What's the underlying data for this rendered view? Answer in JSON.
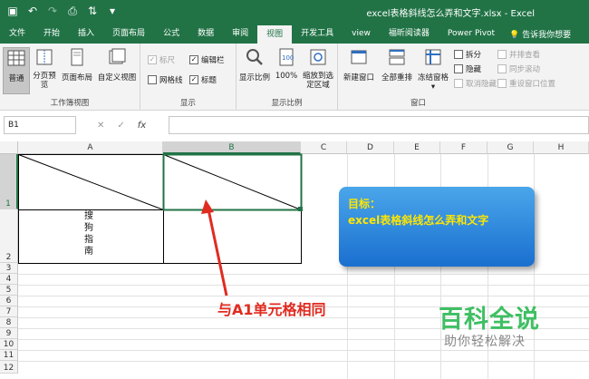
{
  "window": {
    "title": "excel表格斜线怎么弄和文字.xlsx - Excel"
  },
  "ribbon_tabs": [
    "文件",
    "开始",
    "插入",
    "页面布局",
    "公式",
    "数据",
    "审阅",
    "视图",
    "开发工具",
    "view",
    "福昕阅读器",
    "Power Pivot"
  ],
  "active_tab": "视图",
  "tell_me": "告诉我你想要",
  "ribbon": {
    "workbook_views": {
      "label": "工作簿视图",
      "buttons": [
        "普通",
        "分页预览",
        "页面布局",
        "自定义视图"
      ]
    },
    "show": {
      "label": "显示",
      "items": [
        {
          "text": "标尺",
          "checked": true,
          "disabled": true
        },
        {
          "text": "编辑栏",
          "checked": true
        },
        {
          "text": "网格线",
          "checked": false
        },
        {
          "text": "标题",
          "checked": true
        }
      ]
    },
    "zoom": {
      "label": "显示比例",
      "buttons": [
        "显示比例",
        "100%",
        "缩放到选定区域"
      ]
    },
    "window": {
      "label": "窗口",
      "buttons": [
        "新建窗口",
        "全部重排",
        "冻结窗格"
      ],
      "small": [
        "拆分",
        "隐藏",
        "取消隐藏"
      ],
      "small_right": [
        "并排查看",
        "同步滚动",
        "重设窗口位置"
      ]
    }
  },
  "formula_bar": {
    "name_box": "B1",
    "cancel": "✕",
    "enter": "✓",
    "fx": "fx",
    "value": ""
  },
  "grid": {
    "columns": [
      "A",
      "B",
      "C",
      "D",
      "E",
      "F",
      "G",
      "H"
    ],
    "rows": [
      "1",
      "2",
      "3",
      "4",
      "5",
      "6",
      "7",
      "8",
      "9",
      "10",
      "11",
      "12"
    ],
    "a2_chars": [
      "搜",
      "狗",
      "指",
      "南"
    ]
  },
  "callout": {
    "title": "目标：",
    "body": "excel表格斜线怎么弄和文字"
  },
  "annotation": "与A1单元格相同",
  "watermark": {
    "main": "百科全说",
    "sub": "助你轻松解决"
  },
  "colors": {
    "excel_green": "#217346",
    "annotation_red": "#e02b20",
    "callout_text": "#ffe600",
    "watermark_green": "#3fbf63"
  }
}
